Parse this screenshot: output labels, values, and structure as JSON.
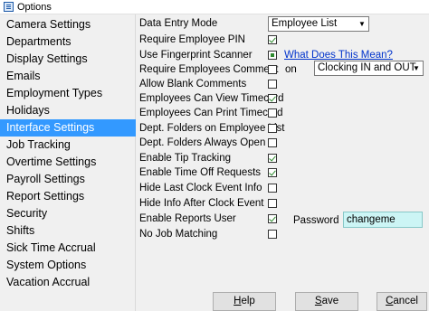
{
  "window": {
    "title": "Options",
    "icon": "options-window-icon"
  },
  "sidebar": {
    "items": [
      {
        "label": "Camera Settings"
      },
      {
        "label": "Departments"
      },
      {
        "label": "Display Settings"
      },
      {
        "label": "Emails"
      },
      {
        "label": "Employment Types"
      },
      {
        "label": "Holidays"
      },
      {
        "label": "Interface Settings",
        "selected": true
      },
      {
        "label": "Job Tracking"
      },
      {
        "label": "Overtime Settings"
      },
      {
        "label": "Payroll Settings"
      },
      {
        "label": "Report Settings"
      },
      {
        "label": "Security"
      },
      {
        "label": "Shifts"
      },
      {
        "label": "Sick Time Accrual"
      },
      {
        "label": "System Options"
      },
      {
        "label": "Vacation Accrual"
      }
    ],
    "selected_color": "#3399ff"
  },
  "settings": {
    "data_entry_mode": {
      "label": "Data Entry Mode",
      "value": "Employee List"
    },
    "rows": [
      {
        "label": "Require Employee PIN",
        "checked": true
      },
      {
        "label": "Use Fingerprint Scanner",
        "checked": "mixed"
      },
      {
        "label": "Require Employees Comment",
        "checked": false
      },
      {
        "label": "Allow Blank Comments",
        "checked": false
      },
      {
        "label": "Employees Can View Timecard",
        "checked": true
      },
      {
        "label": "Employees Can Print Timecard",
        "checked": false
      },
      {
        "label": "Dept. Folders on Employee List",
        "checked": false
      },
      {
        "label": "Dept. Folders Always Open",
        "checked": false
      },
      {
        "label": "Enable Tip Tracking",
        "checked": true
      },
      {
        "label": "Enable Time Off Requests",
        "checked": true
      },
      {
        "label": "Hide Last Clock Event Info",
        "checked": false
      },
      {
        "label": "Hide Info After Clock Event",
        "checked": false
      },
      {
        "label": "Enable Reports User",
        "checked": true
      },
      {
        "label": "No Job Matching",
        "checked": false
      }
    ],
    "what_does_this_mean": "What Does This Mean?",
    "comment_on_label": "on",
    "comment_on_value": "Clocking IN and OUT",
    "password_label": "Password",
    "password_value": "changeme"
  },
  "buttons": {
    "help_first": "H",
    "help_rest": "elp",
    "save_first": "S",
    "save_rest": "ave",
    "cancel_first": "C",
    "cancel_rest": "ancel"
  },
  "colors": {
    "check": "#2d8a2d",
    "link": "#0033cc",
    "password_bg": "#ccf5f5"
  }
}
